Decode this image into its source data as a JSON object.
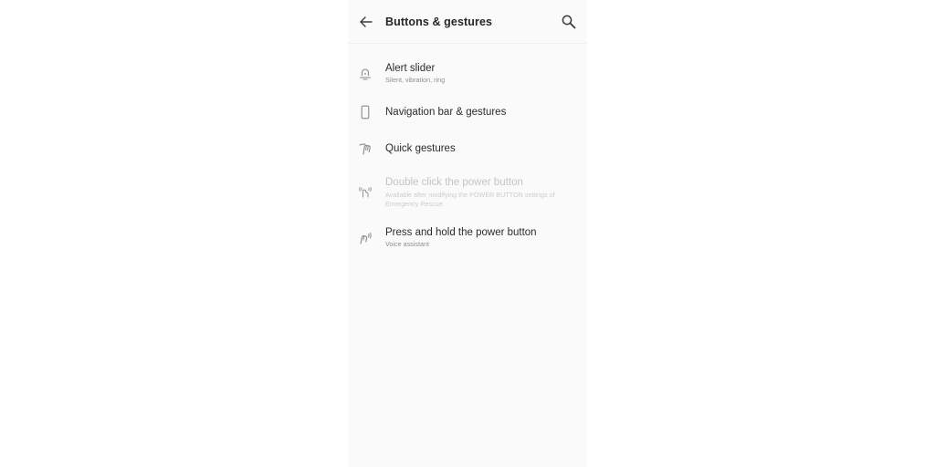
{
  "header": {
    "title": "Buttons & gestures",
    "back_icon": "arrow-left-icon",
    "search_icon": "search-icon"
  },
  "items": [
    {
      "label": "Alert slider",
      "subtitle": "Silent, vibration, ring",
      "icon": "alert-slider-icon",
      "enabled": true
    },
    {
      "label": "Navigation bar & gestures",
      "subtitle": "",
      "icon": "phone-icon",
      "enabled": true
    },
    {
      "label": "Quick gestures",
      "subtitle": "",
      "icon": "gesture-icon",
      "enabled": true
    },
    {
      "label": "Double click the power button",
      "subtitle": "Available after modifying the POWER BUTTON settings of Emergency Rescue",
      "icon": "double-press-icon",
      "enabled": false
    },
    {
      "label": "Press and hold the power button",
      "subtitle": "Voice assistant",
      "icon": "press-hold-icon",
      "enabled": true
    }
  ],
  "colors": {
    "background": "#fafafa",
    "text_primary": "#2b2b2b",
    "text_secondary": "#8e8e8e",
    "text_disabled": "#c4c4c4"
  }
}
